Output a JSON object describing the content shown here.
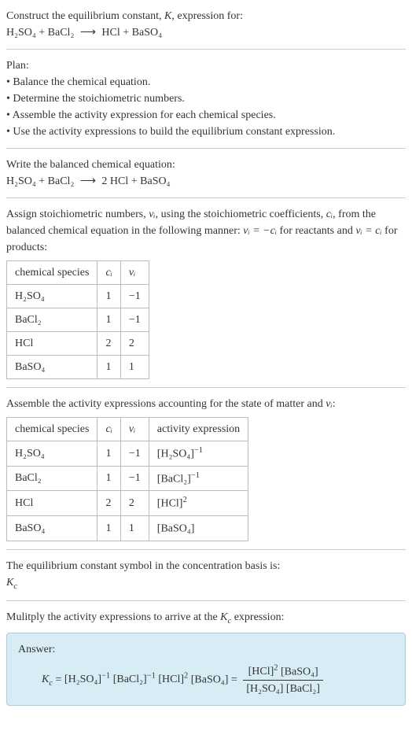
{
  "header": {
    "prompt": "Construct the equilibrium constant, ",
    "K": "K",
    "prompt2": ", expression for:",
    "equation_lhs": "H₂SO₄ + BaCl₂",
    "arrow": "⟶",
    "equation_rhs": "HCl + BaSO₄"
  },
  "plan": {
    "title": "Plan:",
    "items": [
      "• Balance the chemical equation.",
      "• Determine the stoichiometric numbers.",
      "• Assemble the activity expression for each chemical species.",
      "• Use the activity expressions to build the equilibrium constant expression."
    ]
  },
  "balanced": {
    "title": "Write the balanced chemical equation:",
    "lhs": "H₂SO₄ + BaCl₂",
    "arrow": "⟶",
    "rhs": "2 HCl + BaSO₄"
  },
  "stoich_text": {
    "pre": "Assign stoichiometric numbers, ",
    "nu": "νᵢ",
    "mid1": ", using the stoichiometric coefficients, ",
    "ci": "cᵢ",
    "mid2": ", from the balanced chemical equation in the following manner: ",
    "rule1": "νᵢ = −cᵢ",
    "mid3": " for reactants and ",
    "rule2": "νᵢ = cᵢ",
    "mid4": " for products:"
  },
  "table1": {
    "headers": [
      "chemical species",
      "cᵢ",
      "νᵢ"
    ],
    "rows": [
      [
        "H₂SO₄",
        "1",
        "−1"
      ],
      [
        "BaCl₂",
        "1",
        "−1"
      ],
      [
        "HCl",
        "2",
        "2"
      ],
      [
        "BaSO₄",
        "1",
        "1"
      ]
    ]
  },
  "activity_text": {
    "pre": "Assemble the activity expressions accounting for the state of matter and ",
    "nu": "νᵢ",
    "post": ":"
  },
  "table2": {
    "headers": [
      "chemical species",
      "cᵢ",
      "νᵢ",
      "activity expression"
    ],
    "rows": [
      {
        "sp": "H₂SO₄",
        "c": "1",
        "v": "−1",
        "act_base": "[H₂SO₄]",
        "act_exp": "−1"
      },
      {
        "sp": "BaCl₂",
        "c": "1",
        "v": "−1",
        "act_base": "[BaCl₂]",
        "act_exp": "−1"
      },
      {
        "sp": "HCl",
        "c": "2",
        "v": "2",
        "act_base": "[HCl]",
        "act_exp": "2"
      },
      {
        "sp": "BaSO₄",
        "c": "1",
        "v": "1",
        "act_base": "[BaSO₄]",
        "act_exp": ""
      }
    ]
  },
  "basis": {
    "line": "The equilibrium constant symbol in the concentration basis is:",
    "sym": "K",
    "sub": "c"
  },
  "multiply": {
    "pre": "Mulitply the activity expressions to arrive at the ",
    "Kc": "K",
    "sub": "c",
    "post": " expression:"
  },
  "answer": {
    "label": "Answer:",
    "Kc": "K",
    "Kc_sub": "c",
    "eq": " = ",
    "t1_base": "[H₂SO₄]",
    "t1_exp": "−1",
    "t2_base": "[BaCl₂]",
    "t2_exp": "−1",
    "t3_base": "[HCl]",
    "t3_exp": "2",
    "t4_base": "[BaSO₄]",
    "frac_eq": " = ",
    "num_a_base": "[HCl]",
    "num_a_exp": "2",
    "num_b": "[BaSO₄]",
    "den_a": "[H₂SO₄]",
    "den_b": "[BaCl₂]"
  }
}
